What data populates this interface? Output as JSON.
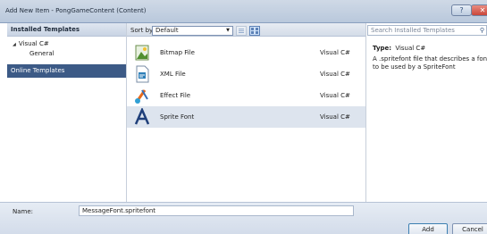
{
  "window": {
    "title": "Add New Item - PongGameContent (Content)",
    "help_glyph": "?",
    "close_glyph": "✕"
  },
  "left_panel": {
    "header": "Installed Templates",
    "tree_root": "Visual C#",
    "tree_child": "General",
    "online": "Online Templates"
  },
  "middle": {
    "sort_label": "Sort by:",
    "sort_value": "Default",
    "items": [
      {
        "name": "Bitmap File",
        "lang": "Visual C#",
        "icon": "bitmap-icon"
      },
      {
        "name": "XML File",
        "lang": "Visual C#",
        "icon": "xml-file-icon"
      },
      {
        "name": "Effect File",
        "lang": "Visual C#",
        "icon": "effect-file-icon"
      },
      {
        "name": "Sprite Font",
        "lang": "Visual C#",
        "icon": "sprite-font-icon",
        "selected": true
      }
    ]
  },
  "right_panel": {
    "search_placeholder": "Search Installed Templates",
    "type_label": "Type:",
    "type_value": "Visual C#",
    "description": "A .spritefont file that describes a font to be used by a SpriteFont"
  },
  "bottom": {
    "name_label": "Name:",
    "name_value": "MessageFont.spritefont",
    "add_label": "Add",
    "cancel_label": "Cancel"
  }
}
